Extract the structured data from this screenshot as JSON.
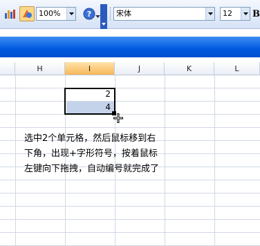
{
  "toolbar": {
    "zoom_value": "100%",
    "font_name": "宋体",
    "font_size": "12",
    "icons": [
      "chart-icon",
      "drawing-icon",
      "help-icon",
      "bold-icon"
    ]
  },
  "columns": [
    "H",
    "I",
    "J",
    "K",
    "L"
  ],
  "selected_column": "I",
  "cells": {
    "i_top": "2",
    "i_bottom": "4"
  },
  "note": {
    "line1": "选中2个单元格，然后鼠标移到右",
    "line2": "下角，出现+字形符号，按着鼠标",
    "line3": "左键向下拖拽，自动编号就完成了"
  },
  "colors": {
    "band": "#0058e0",
    "selection_fill": "#c4d3ea",
    "selected_header": "#f7b75a"
  }
}
